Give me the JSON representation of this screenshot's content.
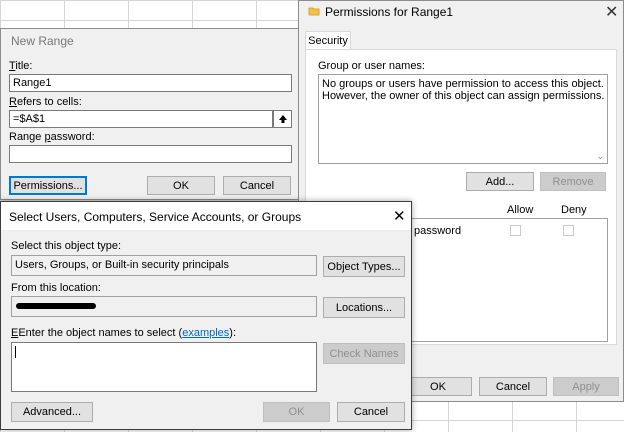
{
  "permissions": {
    "title": "Permissions for Range1",
    "tab_security": "Security",
    "group_label": "Group or user names:",
    "message_line1": "No groups or users have permission to access this object.",
    "message_line2": "However, the owner of this object can assign permissions.",
    "add_label": "Add...",
    "remove_label": "Remove",
    "col_allow": "Allow",
    "col_deny": "Deny",
    "perm_row": "password",
    "ok_label": "OK",
    "cancel_label": "Cancel",
    "apply_label": "Apply"
  },
  "new_range": {
    "title": "New Range",
    "title_label": "Title:",
    "title_value": "Range1",
    "refers_label": "Refers to cells:",
    "refers_value": "=$A$1",
    "password_label": "Range password:",
    "password_value": "",
    "permissions_label": "Permissions...",
    "ok_label": "OK",
    "cancel_label": "Cancel"
  },
  "select_users": {
    "title": "Select Users, Computers, Service Accounts, or Groups",
    "object_type_label": "Select this object type:",
    "object_type_value": "Users, Groups, or Built-in security principals",
    "object_types_button": "Object Types...",
    "location_label": "From this location:",
    "locations_button": "Locations...",
    "enter_label_pre": "Enter the object names to select (",
    "examples_link": "examples",
    "enter_label_post": "):",
    "check_names_label": "Check Names",
    "advanced_label": "Advanced...",
    "ok_label": "OK",
    "cancel_label": "Cancel"
  },
  "colors": {
    "link": "#0066cc",
    "focus": "#0078d7"
  }
}
